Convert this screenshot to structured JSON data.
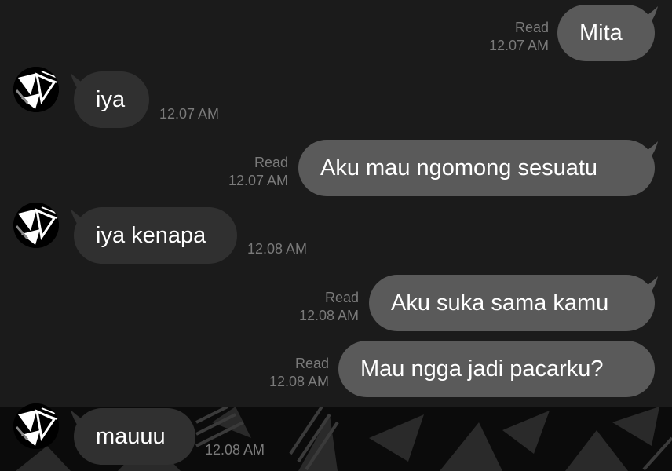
{
  "colors": {
    "background": "#1b1b1b",
    "outgoing_bubble": "#5a5a5a",
    "incoming_bubble": "#303030",
    "meta_text": "#7a7a7a"
  },
  "contact": {
    "avatar_icon": "geometric-avatar-icon"
  },
  "messages": [
    {
      "direction": "outgoing",
      "text": "Mita",
      "status": "Read",
      "time": "12.07 AM"
    },
    {
      "direction": "incoming",
      "text": "iya",
      "time": "12.07 AM"
    },
    {
      "direction": "outgoing",
      "text": "Aku mau ngomong sesuatu",
      "status": "Read",
      "time": "12.07 AM"
    },
    {
      "direction": "incoming",
      "text": "iya kenapa",
      "time": "12.08 AM"
    },
    {
      "direction": "outgoing",
      "text": "Aku suka sama kamu",
      "status": "Read",
      "time": "12.08 AM"
    },
    {
      "direction": "outgoing",
      "text": "Mau ngga jadi pacarku?",
      "status": "Read",
      "time": "12.08 AM"
    },
    {
      "direction": "incoming",
      "text": "mauuu",
      "time": "12.08 AM"
    }
  ]
}
